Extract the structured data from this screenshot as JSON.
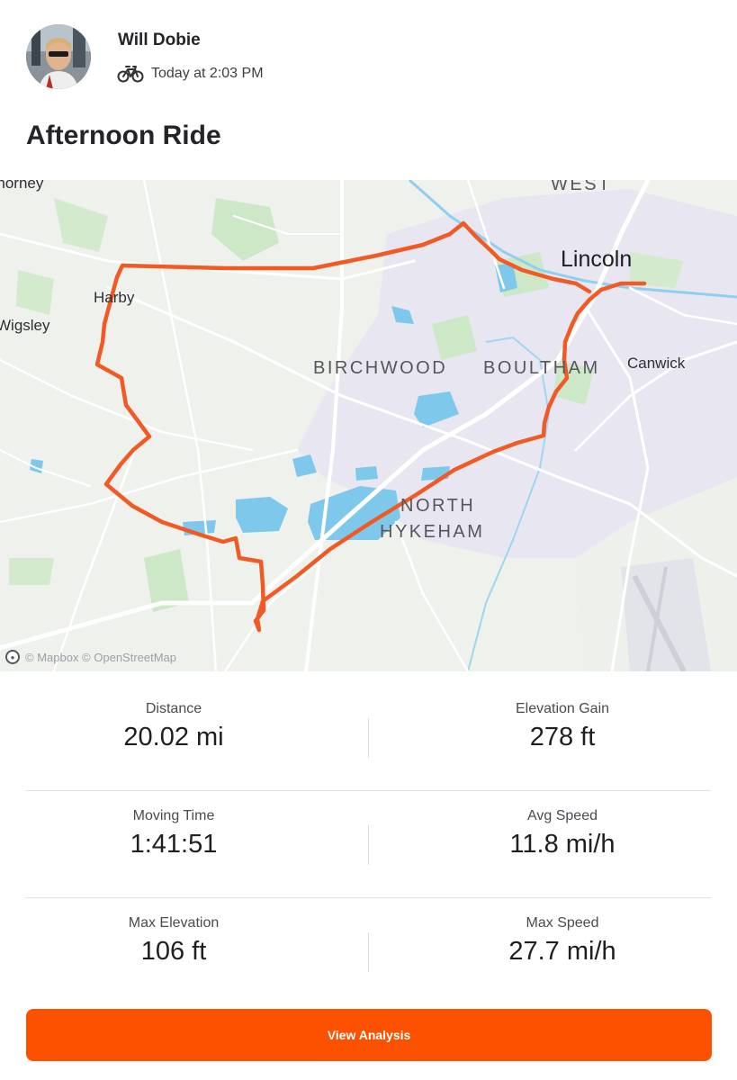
{
  "header": {
    "athlete_name": "Will Dobie",
    "timestamp": "Today at 2:03 PM",
    "activity_icon": "bike-icon",
    "activity_title": "Afternoon Ride"
  },
  "map": {
    "labels": {
      "lincoln": "Lincoln",
      "birchwood": "BIRCHWOOD",
      "boultham": "BOULTHAM",
      "north": "NORTH",
      "hykeham": "HYKEHAM",
      "canwick": "Canwick",
      "harby": "Harby",
      "wigsley": "Wigsley",
      "thorney": "Thorney",
      "west": "WEST"
    },
    "attribution": "© Mapbox © OpenStreetMap",
    "route_color": "#f15a24"
  },
  "stats": {
    "distance_label": "Distance",
    "distance_value": "20.02 mi",
    "elevation_gain_label": "Elevation Gain",
    "elevation_gain_value": "278 ft",
    "moving_time_label": "Moving Time",
    "moving_time_value": "1:41:51",
    "avg_speed_label": "Avg Speed",
    "avg_speed_value": "11.8 mi/h",
    "max_elevation_label": "Max Elevation",
    "max_elevation_value": "106 ft",
    "max_speed_label": "Max Speed",
    "max_speed_value": "27.7 mi/h"
  },
  "actions": {
    "view_analysis_label": "View Analysis"
  },
  "colors": {
    "brand": "#fc5200",
    "route": "#f15a24",
    "water": "#7ec8ec",
    "park": "#cde8c6"
  }
}
